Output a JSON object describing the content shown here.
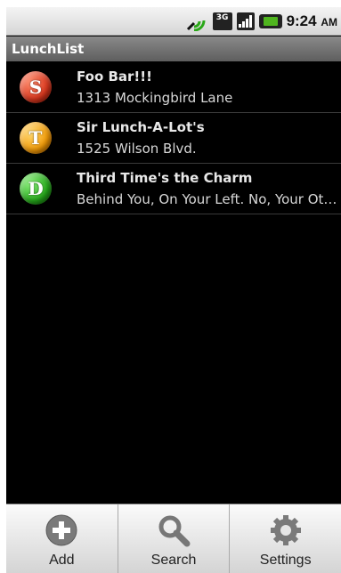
{
  "status_bar": {
    "time": "9:24",
    "ampm": "AM",
    "network": "3G"
  },
  "app": {
    "title": "LunchList"
  },
  "restaurants": [
    {
      "badge": "S",
      "badge_color": "#d8361d",
      "name": "Foo Bar!!!",
      "address": "1313 Mockingbird Lane"
    },
    {
      "badge": "T",
      "badge_color": "#f29a06",
      "name": "Sir Lunch-A-Lot's",
      "address": "1525 Wilson Blvd."
    },
    {
      "badge": "D",
      "badge_color": "#25a81a",
      "name": "Third Time's the Charm",
      "address": "Behind You, On Your Left. No, Your Other Left."
    }
  ],
  "menu": {
    "add_label": "Add",
    "search_label": "Search",
    "settings_label": "Settings",
    "add_icon": "plus-circle-icon",
    "search_icon": "magnifier-icon",
    "settings_icon": "gear-icon"
  }
}
